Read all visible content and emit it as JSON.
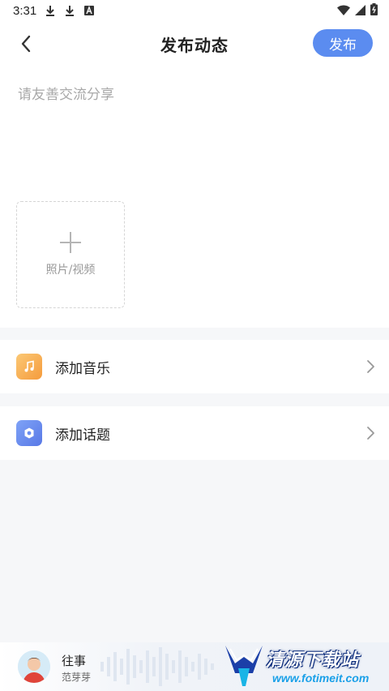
{
  "status_bar": {
    "time": "3:31"
  },
  "header": {
    "title": "发布动态",
    "publish_label": "发布"
  },
  "editor": {
    "placeholder": "请友善交流分享",
    "upload_label": "照片/视频"
  },
  "options": [
    {
      "label": "添加音乐",
      "icon": "music-note-icon",
      "color": "#f7b356"
    },
    {
      "label": "添加话题",
      "icon": "topic-hash-icon",
      "color": "#6b8ef2"
    }
  ],
  "player": {
    "title": "往事",
    "artist": "范芽芽"
  },
  "watermark": {
    "text_cn": "清源下载站",
    "text_url": "www.fotimeit.com"
  },
  "colors": {
    "accent": "#5b8cf0",
    "background": "#f6f7f9"
  }
}
